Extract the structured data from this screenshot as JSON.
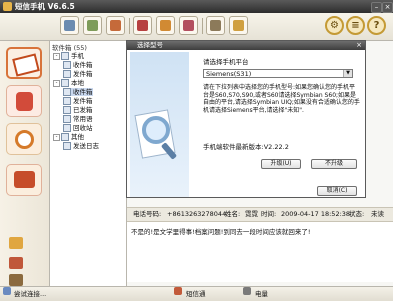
{
  "window": {
    "title": "短信手机 V6.6.5",
    "minimize": "–",
    "close": "×"
  },
  "toolbar": {
    "buttons": [
      {
        "icon": "new-message-icon",
        "color": "#6b8bb0"
      },
      {
        "icon": "reply-icon",
        "color": "#7e9c5a"
      },
      {
        "icon": "forward-icon",
        "color": "#c56a3a"
      },
      {
        "icon": "delete-icon",
        "color": "#b74040"
      },
      {
        "icon": "send-icon",
        "color": "#d18a33"
      },
      {
        "icon": "mail-icon",
        "color": "#b34f5f"
      },
      {
        "icon": "print-icon",
        "color": "#8c7a5a"
      },
      {
        "icon": "search-icon",
        "color": "#d0a040"
      }
    ],
    "right_buttons": [
      "⚙",
      "≡",
      "?"
    ]
  },
  "tree": {
    "header": "软件箱 (55)",
    "nodes": [
      {
        "label": "手机",
        "level": 1,
        "expander": "-"
      },
      {
        "label": "收件箱",
        "level": 2
      },
      {
        "label": "发件箱",
        "level": 2
      },
      {
        "label": "本地",
        "level": 1,
        "expander": "-"
      },
      {
        "label": "收件箱",
        "level": 2,
        "selected": true
      },
      {
        "label": "发件箱",
        "level": 2
      },
      {
        "label": "已发箱",
        "level": 2
      },
      {
        "label": "常用语",
        "level": 2
      },
      {
        "label": "回收站",
        "level": 2
      },
      {
        "label": "其他",
        "level": 1,
        "expander": "-"
      },
      {
        "label": "发送日志",
        "level": 2
      }
    ]
  },
  "message_info": {
    "phone_label": "电话号码:",
    "phone": "+8613263278044",
    "name_label": "姓名:",
    "name": "霓霓",
    "time_label": "时间:",
    "time": "2009-04-17 18:52:38",
    "status_label": "状态:",
    "status": "未读"
  },
  "message_body": "不是的!是文学里得事!档案问题!到同去一段时间应该就回来了!",
  "dialog": {
    "title": "选择型号",
    "close": "×",
    "select_label": "请选择手机平台",
    "select_value": "Siemens(S31)",
    "description": "请在下拉列表中选择您的手机型号:如果您确认您的手机平台是S60,S70,S90,或者S60请选择Symbian S60;如果是自由的平台,请选择Symbian UIQ;如果没有合适确认您的手机请选择Siemens平台,请选择\"未知\".",
    "version_label": "手机端软件最新版本:",
    "version": "V2.22.2",
    "upgrade_button": "升级(U)",
    "no_upgrade_button": "不升级",
    "cancel_button": "取消(C)"
  },
  "statusbar": {
    "connection": "尝试连接...",
    "sms_center": "短信通",
    "battery": "电量"
  }
}
